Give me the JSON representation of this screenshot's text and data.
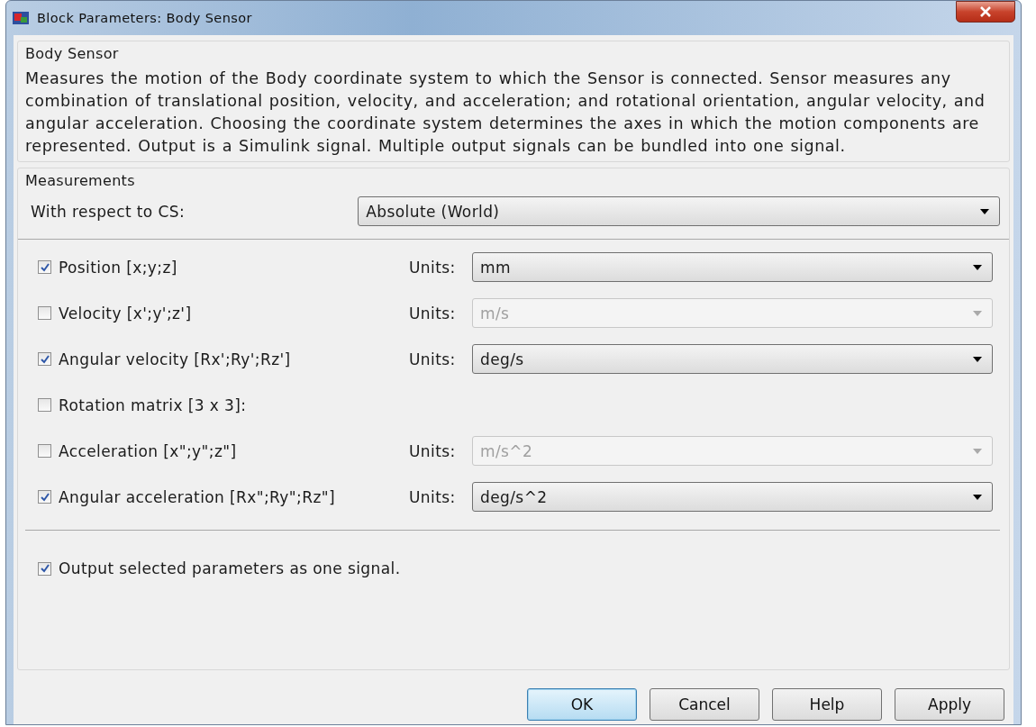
{
  "window": {
    "title": "Block Parameters: Body Sensor"
  },
  "description": {
    "heading": "Body Sensor",
    "text": "Measures the motion of the Body coordinate system to which the Sensor is connected. Sensor measures any combination of translational position, velocity, and acceleration; and rotational orientation, angular velocity, and angular acceleration. Choosing the coordinate system determines the axes in which the motion components are represented. Output is a Simulink signal. Multiple output signals can be bundled into one signal."
  },
  "measurements": {
    "heading": "Measurements",
    "reference": {
      "label": "With respect to CS:",
      "value": "Absolute (World)"
    },
    "rows": [
      {
        "kind": "units",
        "label": "Position [x;y;z]",
        "checked": true,
        "units_label": "Units:",
        "units": "mm"
      },
      {
        "kind": "units",
        "label": "Velocity [x';y';z']",
        "checked": false,
        "units_label": "Units:",
        "units": "m/s"
      },
      {
        "kind": "units",
        "label": "Angular velocity [Rx';Ry';Rz']",
        "checked": true,
        "units_label": "Units:",
        "units": "deg/s"
      },
      {
        "kind": "plain",
        "label": "Rotation matrix [3 x 3]:",
        "checked": false
      },
      {
        "kind": "units",
        "label": "Acceleration [x\";y\";z\"]",
        "checked": false,
        "units_label": "Units:",
        "units": "m/s^2"
      },
      {
        "kind": "units",
        "label": "Angular acceleration [Rx\";Ry\";Rz\"]",
        "checked": true,
        "units_label": "Units:",
        "units": "deg/s^2"
      }
    ],
    "output": {
      "label": "Output selected parameters as one signal.",
      "checked": true
    }
  },
  "buttons": [
    {
      "label": "OK",
      "default": true
    },
    {
      "label": "Cancel",
      "default": false
    },
    {
      "label": "Help",
      "default": false
    },
    {
      "label": "Apply",
      "default": false
    }
  ]
}
